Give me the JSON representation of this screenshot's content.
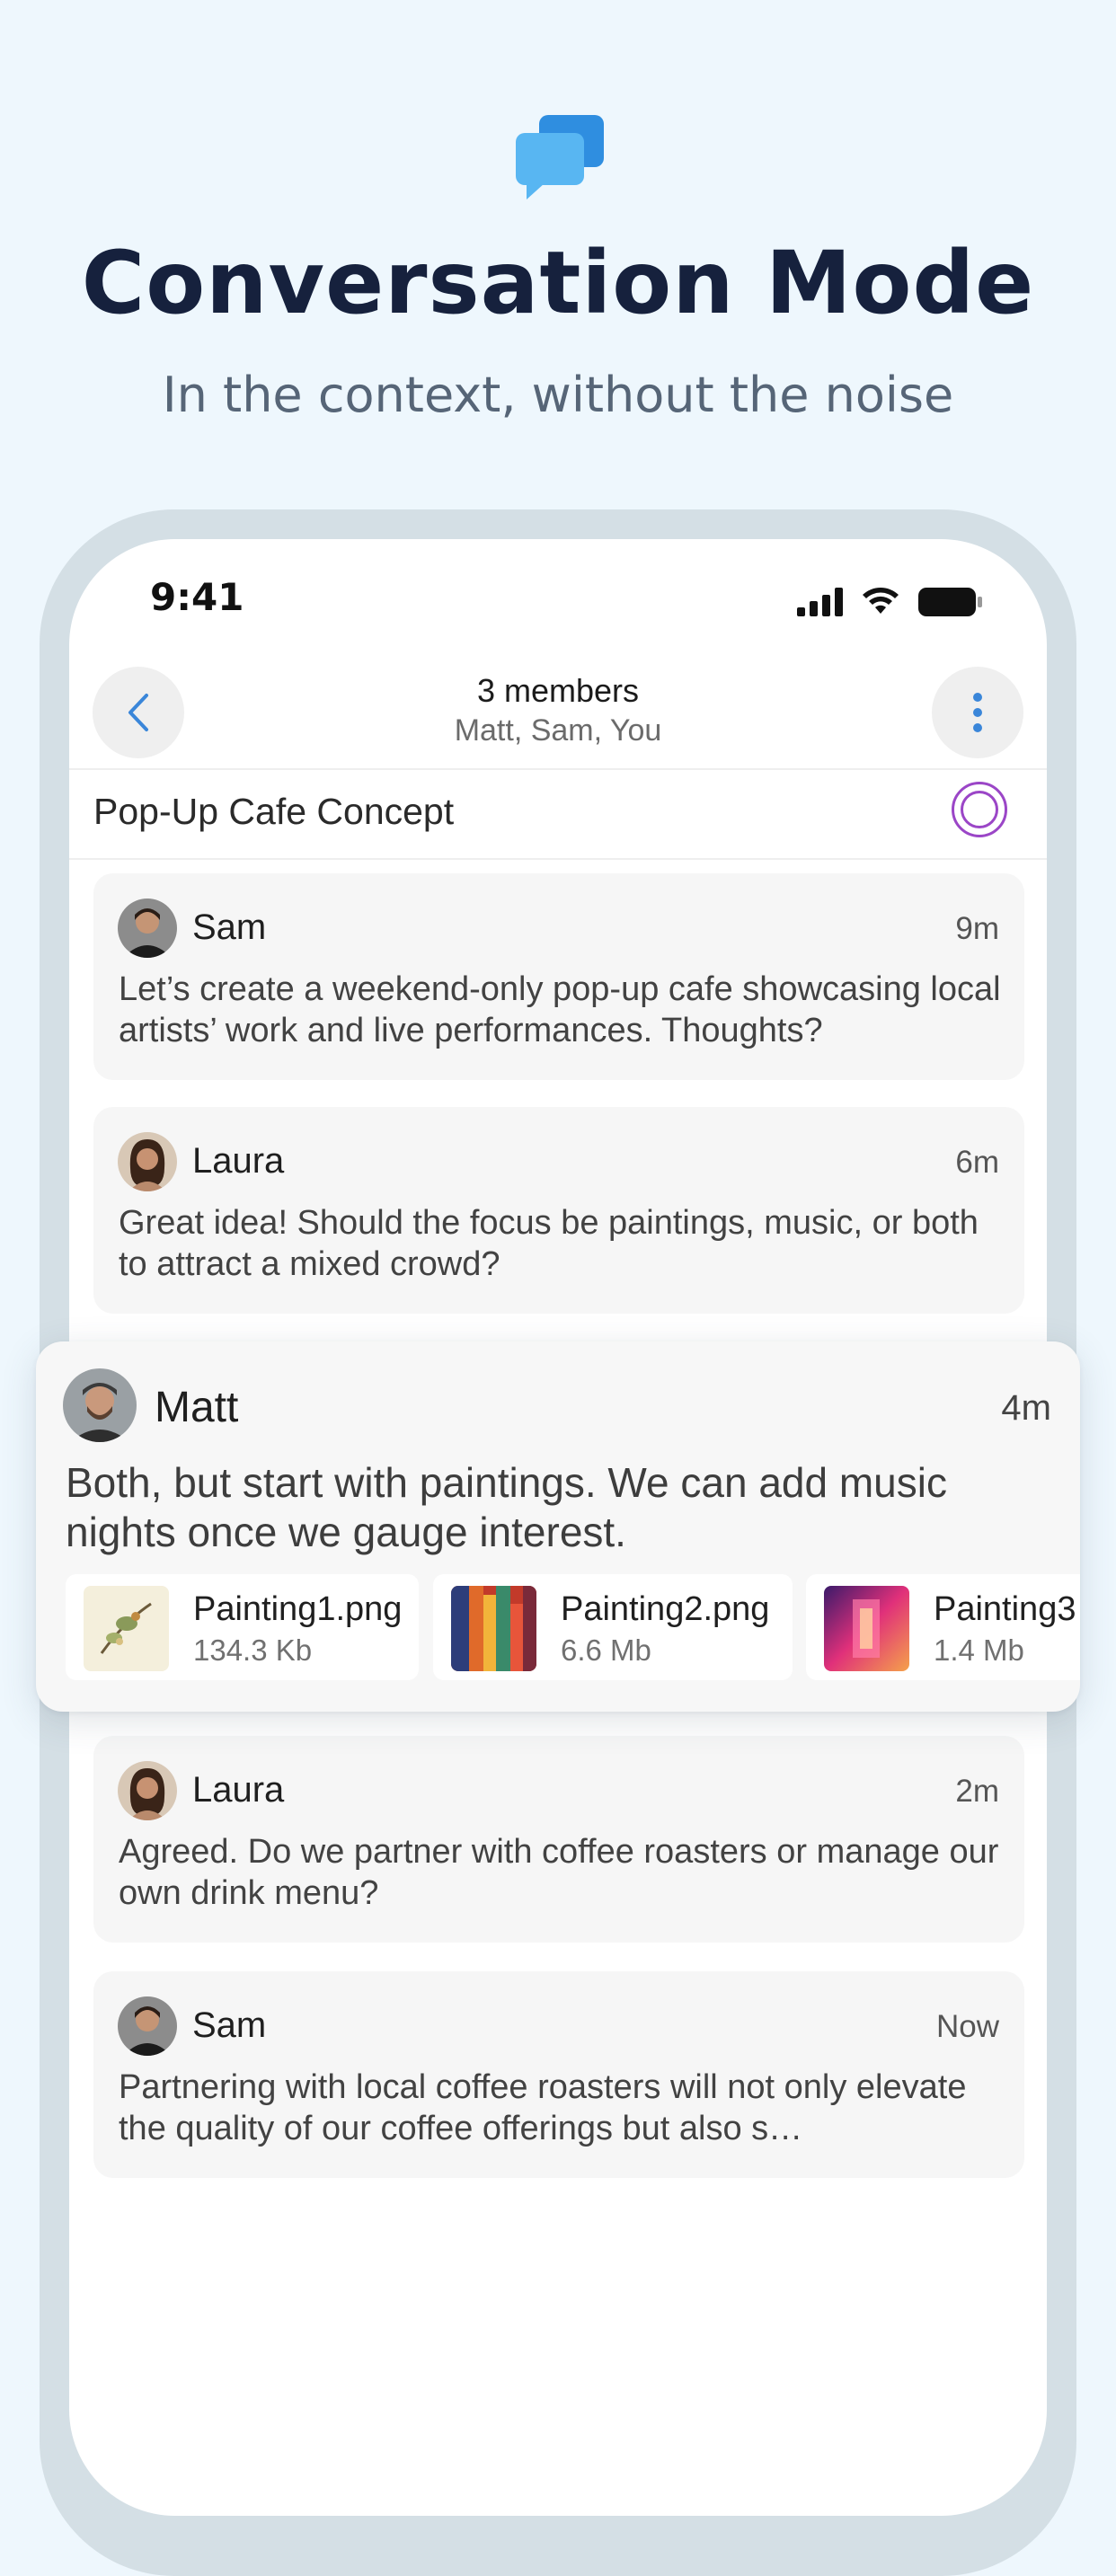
{
  "hero": {
    "title": "Conversation Mode",
    "subtitle": "In the context, without the noise",
    "icon": "chat-bubbles-icon"
  },
  "colors": {
    "background": "#eef7fd",
    "accent_blue": "#3a9ae6",
    "topic_ring": "#9b46c7",
    "card_bg": "#f6f6f6"
  },
  "status_bar": {
    "time": "9:41"
  },
  "header": {
    "members_title": "3 members",
    "members_names": "Matt, Sam, You"
  },
  "topic": {
    "title": "Pop-Up Cafe Concept"
  },
  "messages": [
    {
      "name": "Sam",
      "time": "9m",
      "text": "Let’s create a weekend-only pop-up cafe showcasing local artists’ work and live performances. Thoughts?"
    },
    {
      "name": "Laura",
      "time": "6m",
      "text": "Great idea! Should the focus be paintings, music, or both to attract a mixed crowd?"
    },
    {
      "name": "Laura",
      "time": "2m",
      "text": "Agreed. Do we partner with coffee roasters or manage our own drink menu?"
    },
    {
      "name": "Sam",
      "time": "Now",
      "text": "Partnering with local coffee roasters will not only elevate the quality of our coffee offerings but also s…"
    }
  ],
  "highlight": {
    "name": "Matt",
    "time": "4m",
    "text": "Both, but start with paintings. We can add music nights once we gauge interest.",
    "attachments": [
      {
        "name": "Painting1.png",
        "size": "134.3 Kb"
      },
      {
        "name": "Painting2.png",
        "size": "6.6 Mb"
      },
      {
        "name": "Painting3",
        "size": "1.4 Mb"
      }
    ]
  }
}
